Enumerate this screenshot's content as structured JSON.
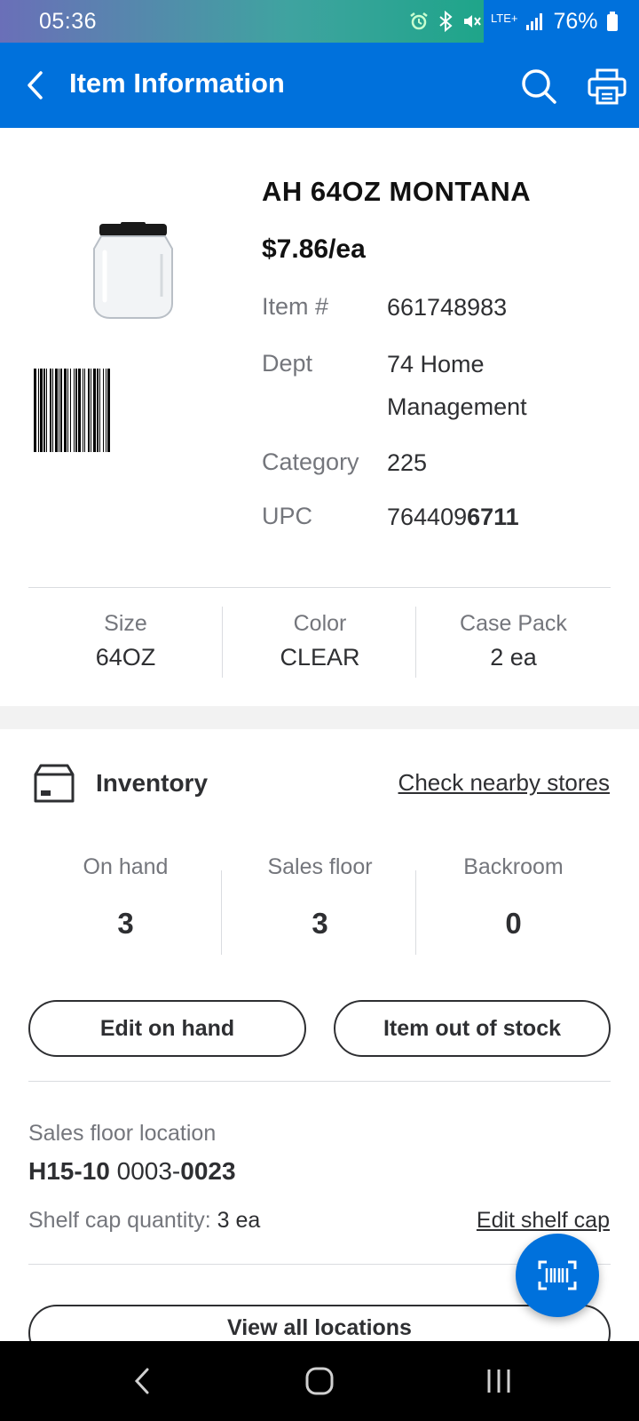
{
  "status_bar": {
    "time": "05:36",
    "network": "LTE+",
    "battery": "76%"
  },
  "app_bar": {
    "title": "Item Information"
  },
  "product": {
    "name": "AH 64OZ MONTANA",
    "price": "$7.86/ea",
    "specs": {
      "item_label": "Item #",
      "item_value": "661748983",
      "dept_label": "Dept",
      "dept_value_line1": "74 Home",
      "dept_value_line2": "Management",
      "category_label": "Category",
      "category_value": "225",
      "upc_label": "UPC",
      "upc_value_prefix": "764409",
      "upc_value_bold": "6711"
    }
  },
  "attributes": [
    {
      "label": "Size",
      "value": "64OZ"
    },
    {
      "label": "Color",
      "value": "CLEAR"
    },
    {
      "label": "Case Pack",
      "value": "2 ea"
    }
  ],
  "inventory": {
    "title": "Inventory",
    "nearby_link": "Check nearby stores",
    "counts": [
      {
        "label": "On hand",
        "value": "3"
      },
      {
        "label": "Sales floor",
        "value": "3"
      },
      {
        "label": "Backroom",
        "value": "0"
      }
    ],
    "edit_on_hand": "Edit on hand",
    "out_of_stock": "Item out of stock"
  },
  "location": {
    "label": "Sales floor location",
    "value_part1": "H15-10",
    "value_part2": " 0003-",
    "value_part3": "0023",
    "shelf_cap_label": "Shelf cap quantity: ",
    "shelf_cap_value": "3 ea",
    "edit_shelf_cap": "Edit shelf cap",
    "view_all": "View all locations"
  },
  "colors": {
    "brand_blue": "#0071dc",
    "text_dark": "#2e2f32",
    "text_gray": "#74767c"
  }
}
